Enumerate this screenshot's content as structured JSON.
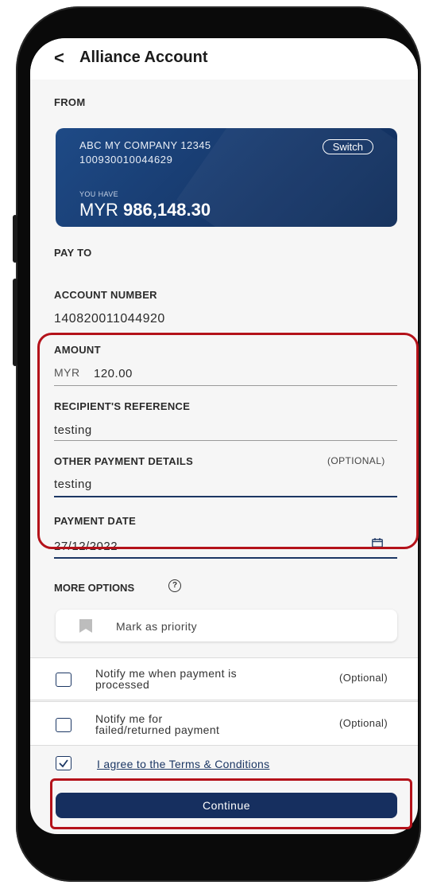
{
  "header": {
    "back_icon": "chevron-left-icon",
    "title": "Alliance Account"
  },
  "from": {
    "label": "FROM",
    "company": "ABC MY COMPANY 12345",
    "account_no": "100930010044629",
    "switch_label": "Switch",
    "you_have": "YOU HAVE",
    "currency": "MYR",
    "balance": "986,148.30"
  },
  "pay_to": {
    "label": "PAY TO",
    "account_number_label": "ACCOUNT NUMBER",
    "account_number": "140820011044920"
  },
  "form": {
    "amount_label": "AMOUNT",
    "amount_currency": "MYR",
    "amount_value": "120.00",
    "reference_label": "RECIPIENT'S REFERENCE",
    "reference_value": "testing",
    "other_label": "OTHER PAYMENT DETAILS",
    "other_optional": "(OPTIONAL)",
    "other_value": "testing",
    "date_label": "PAYMENT DATE",
    "date_value": "27/12/2022"
  },
  "more_options": {
    "label": "MORE OPTIONS",
    "help_icon": "?",
    "priority_label": "Mark as priority"
  },
  "notify": {
    "processed_line1": "Notify me when payment is",
    "processed_line2": "processed",
    "processed_optional": "(Optional)",
    "failed_line1": "Notify me for",
    "failed_line2": "failed/returned payment",
    "failed_optional": "(Optional)"
  },
  "terms": {
    "label": "I agree to the Terms & Conditions",
    "checked": true
  },
  "continue_label": "Continue",
  "colors": {
    "brand": "#162f5f",
    "highlight": "#b4121a",
    "card": "#17396c"
  }
}
